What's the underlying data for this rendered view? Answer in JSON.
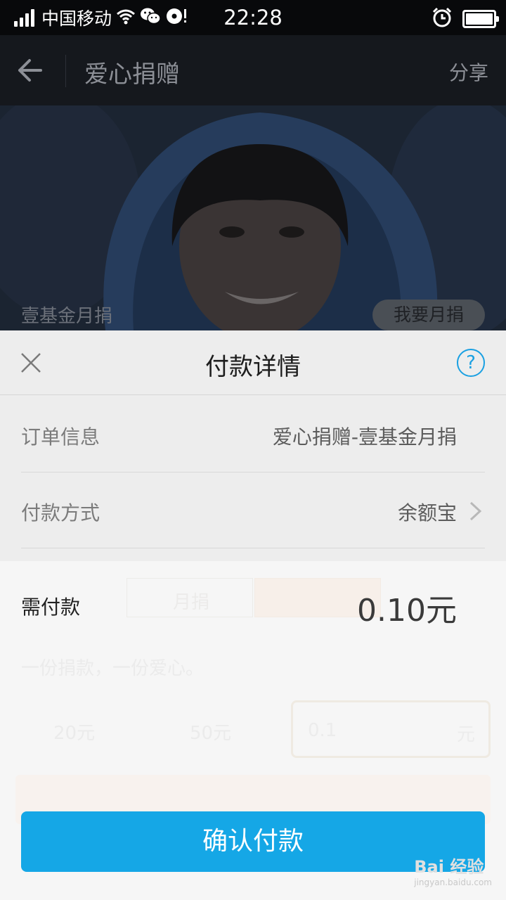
{
  "status_bar": {
    "carrier": "中国移动",
    "time": "22:28",
    "battery_level": 1.0,
    "signal_bars": 4
  },
  "app_bar": {
    "back_icon": "back-arrow-icon",
    "title": "爱心捐赠",
    "share_label": "分享"
  },
  "hero": {
    "caption": "壹基金月捐",
    "button_label": "我要月捐"
  },
  "background": {
    "tab_monthly": "月捐",
    "slogan": "一份捐款，一份爱心。",
    "amount_20": "20元",
    "amount_50": "50元",
    "custom_amount": "0.1",
    "custom_unit": "元"
  },
  "sheet": {
    "title": "付款详情",
    "close_icon": "close-icon",
    "help_icon": "help-icon",
    "order_label": "订单信息",
    "order_value": "爱心捐赠-壹基金月捐",
    "method_label": "付款方式",
    "method_value": "余额宝",
    "amount_label": "需付款",
    "amount_value": "0.10元",
    "confirm_label": "确认付款"
  },
  "watermark": {
    "main": "Bai 经验",
    "sub": "jingyan.baidu.com"
  },
  "colors": {
    "accent": "#15a7e6",
    "status_bar": "#08090b",
    "app_bar": "#15181d"
  }
}
